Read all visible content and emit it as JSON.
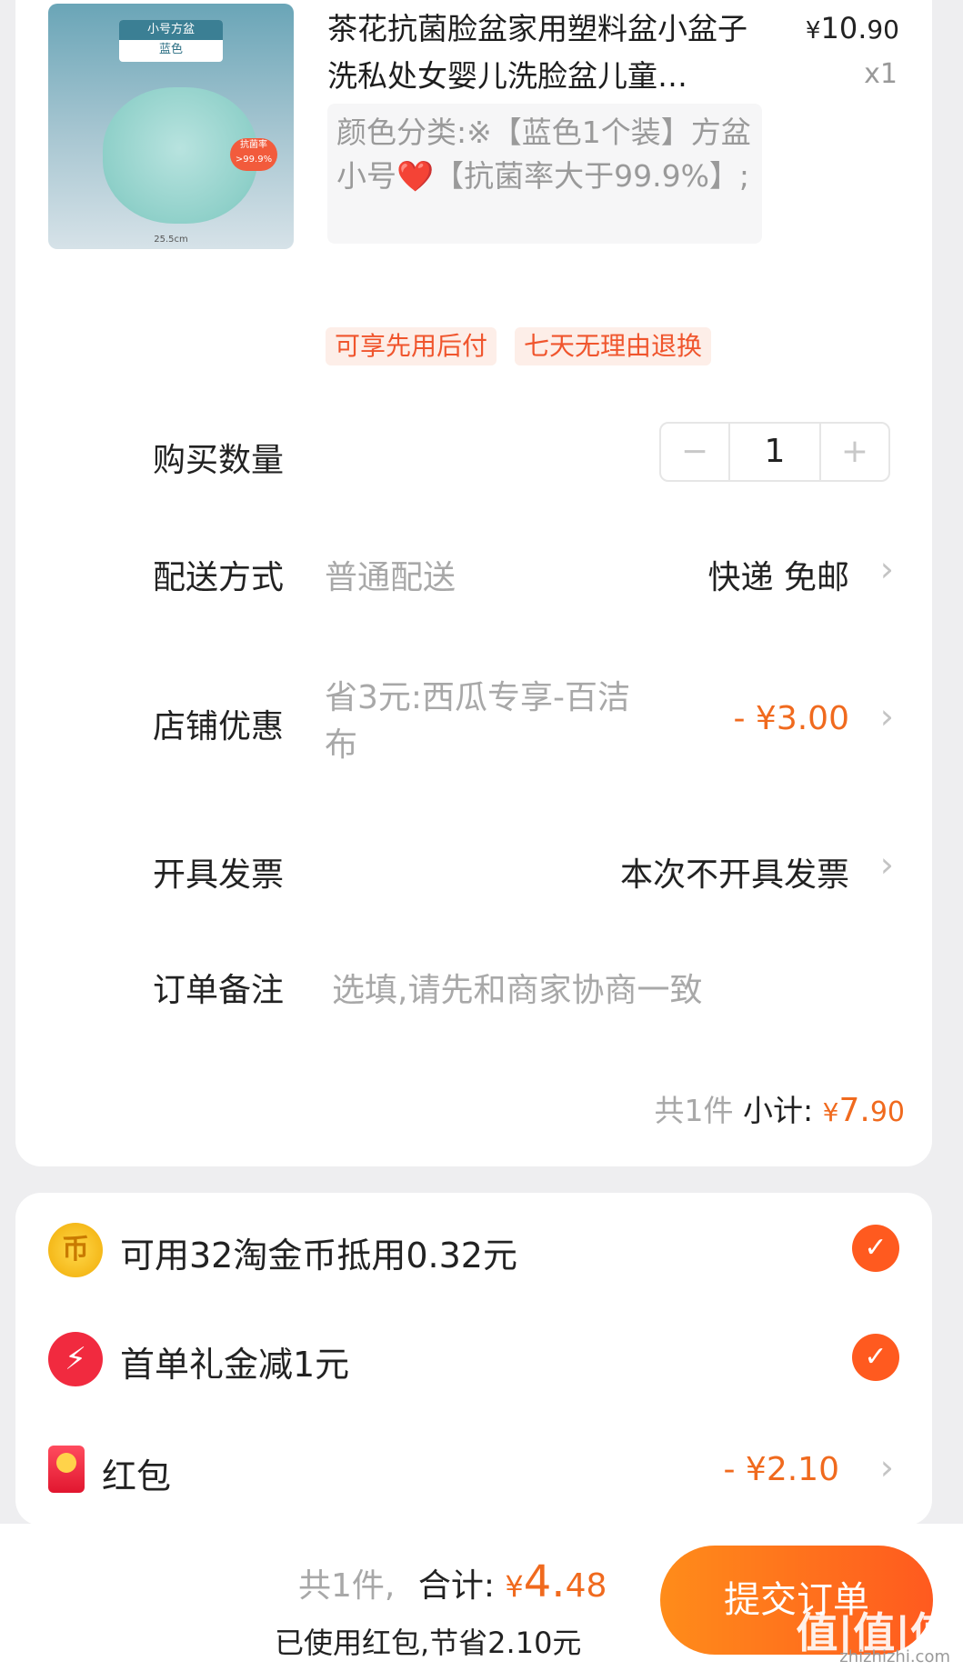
{
  "product": {
    "thumb_tag_top": "小号方盆",
    "thumb_tag_bottom": "蓝色",
    "thumb_badge": "抗菌率>99.9%",
    "thumb_dimension": "25.5cm",
    "title": "茶花抗菌脸盆家用塑料盆小盆子洗私处女婴儿洗脸盆儿童…",
    "price_symbol": "¥",
    "price_int": "10.",
    "price_cents": "90",
    "quantity_text": "x1",
    "spec": "颜色分类:※【蓝色1个装】方盆小号❤️【抗菌率大于99.9%】;",
    "tags": [
      "可享先用后付",
      "七天无理由退换"
    ]
  },
  "order": {
    "qty_label": "购买数量",
    "qty_minus": "−",
    "qty_value": "1",
    "qty_plus": "+",
    "delivery_label": "配送方式",
    "delivery_type": "普通配送",
    "delivery_value": "快递 免邮",
    "store_discount_label": "店铺优惠",
    "store_discount_desc": "省3元:西瓜专享-百洁布",
    "store_discount_value": "- ¥3.00",
    "invoice_label": "开具发票",
    "invoice_value": "本次不开具发票",
    "note_label": "订单备注",
    "note_placeholder": "选填,请先和商家协商一致",
    "subtotal_count": "共1件",
    "subtotal_label": "小计:",
    "subtotal_symbol": "¥",
    "subtotal_int": "7.",
    "subtotal_cents": "90"
  },
  "benefits": {
    "coin_text": "可用32淘金币抵用0.32元",
    "coin_icon": "币",
    "first_order_text": "首单礼金减1元",
    "first_order_icon": "⚡",
    "hongbao_label": "红包",
    "hongbao_value": "- ¥2.10"
  },
  "footer": {
    "count": "共1件,",
    "total_label": "合计:",
    "total_symbol": "¥",
    "total_int": "4.",
    "total_cents": "48",
    "saved_text": "已使用红包,节省2.10元",
    "submit_label": "提交订单"
  },
  "watermark": {
    "main": "值|值|值",
    "sub": "zhizhizhi.com"
  },
  "colors": {
    "accent": "#f06a1e",
    "submit_start": "#ff8c1a",
    "submit_end": "#ff5a1f"
  }
}
